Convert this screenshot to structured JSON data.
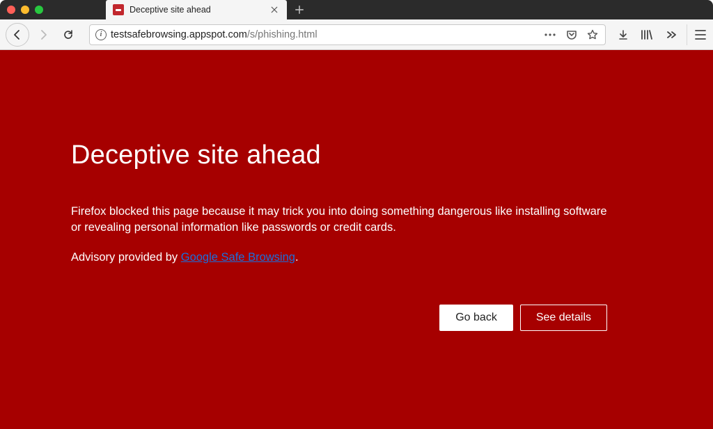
{
  "tab": {
    "title": "Deceptive site ahead"
  },
  "url": {
    "domain": "testsafebrowsing.appspot.com",
    "path": "/s/phishing.html"
  },
  "warning": {
    "title": "Deceptive site ahead",
    "body": "Firefox blocked this page because it may trick you into doing something dangerous like installing software or revealing personal information like passwords or credit cards.",
    "advisory_prefix": "Advisory provided by ",
    "advisory_link": "Google Safe Browsing",
    "advisory_suffix": ".",
    "go_back": "Go back",
    "see_details": "See details"
  },
  "colors": {
    "danger_bg": "#a60000",
    "link": "#1b6fdc"
  }
}
